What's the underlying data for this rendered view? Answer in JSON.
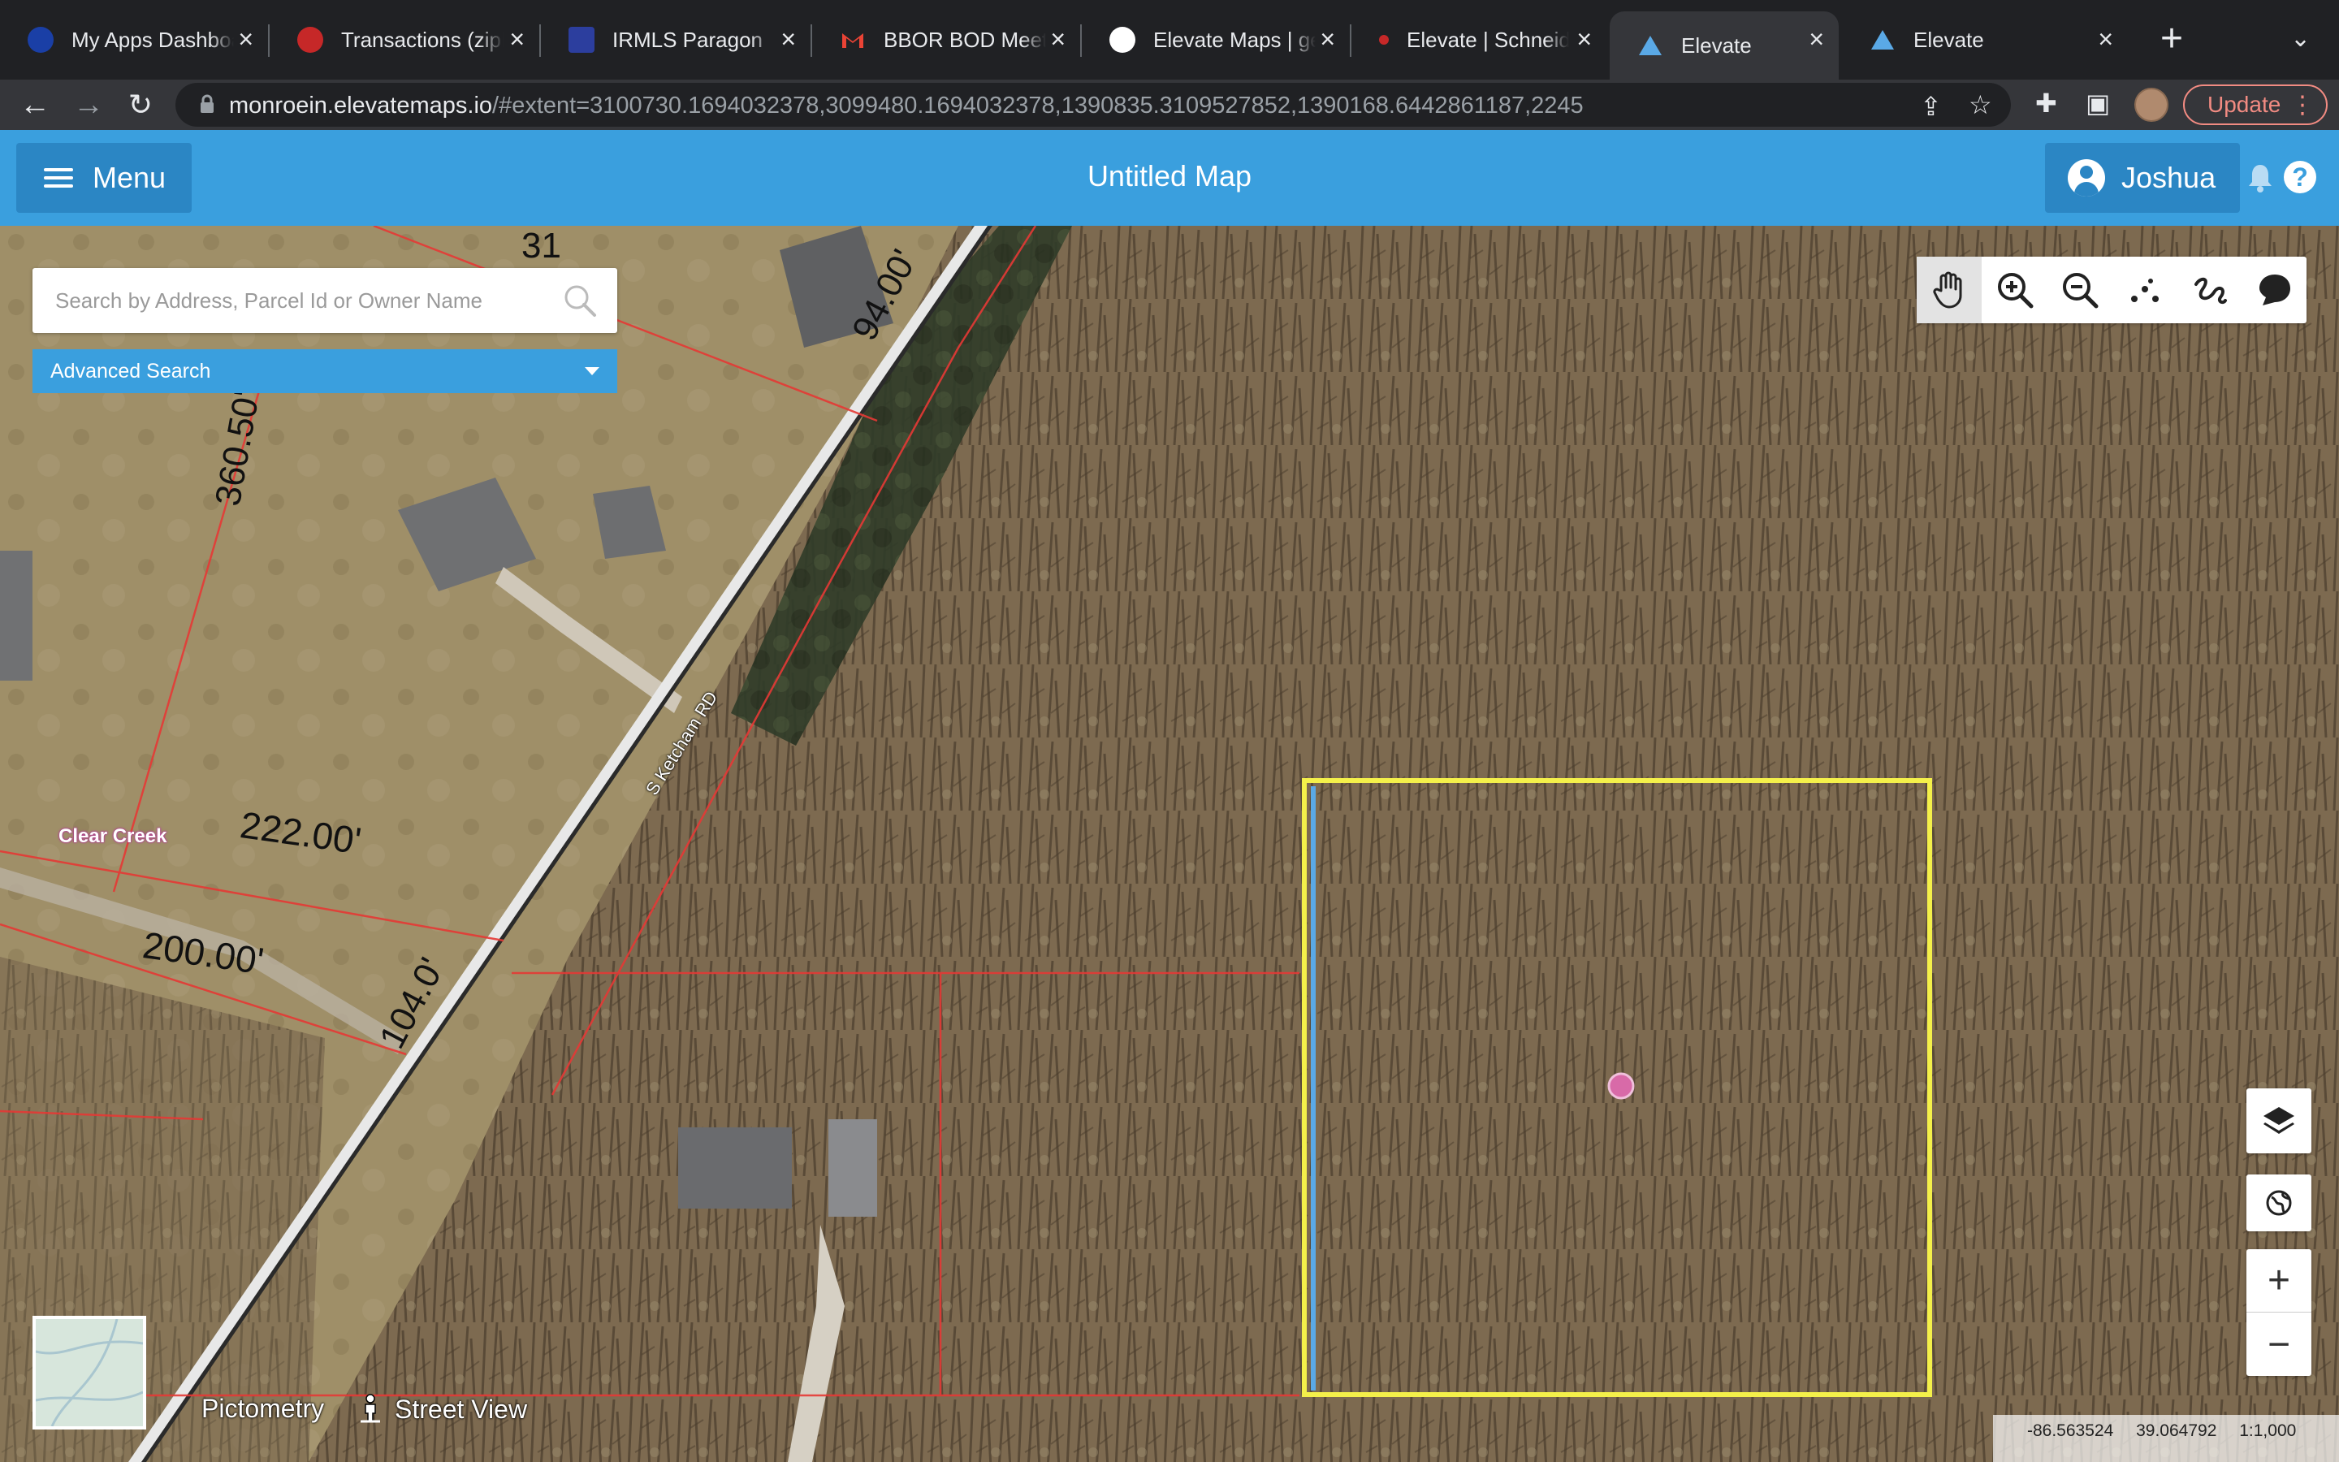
{
  "browser": {
    "tabs": [
      {
        "label": "My Apps Dashboard",
        "icon": "okta-icon",
        "color": "#1a3fa6"
      },
      {
        "label": "Transactions (zipForm)",
        "icon": "zipform-icon",
        "color": "#c62828"
      },
      {
        "label": "IRMLS Paragon",
        "icon": "paragon-icon",
        "color": "#2c3e9e"
      },
      {
        "label": "BBOR BOD Meeting",
        "icon": "gmail-icon",
        "color": "#ea4335"
      },
      {
        "label": "Elevate Maps | geo",
        "icon": "globe-icon",
        "color": "#ffffff"
      },
      {
        "label": "Elevate | Schneider",
        "icon": "schneider-icon",
        "color": "#c62828"
      },
      {
        "label": "Elevate",
        "icon": "elevate-icon",
        "color": "#5aa9e6",
        "active": true
      },
      {
        "label": "Elevate",
        "icon": "elevate-icon",
        "color": "#5aa9e6"
      }
    ],
    "url_host": "monroein.elevatemaps.io",
    "url_rest": "/#extent=3100730.1694032378,3099480.1694032378,1390835.3109527852,1390168.6442861187,2245",
    "update_label": "Update"
  },
  "app": {
    "menu_label": "Menu",
    "title": "Untitled Map",
    "user_name": "Joshua",
    "help_label": "?"
  },
  "search": {
    "placeholder": "Search by Address, Parcel Id or Owner Name",
    "advanced_label": "Advanced Search"
  },
  "map_labels": {
    "road": "S Ketcham RD",
    "creek": "Clear Creek",
    "dim_360": "360.50'",
    "dim_94": "94.00'",
    "dim_222": "222.00'",
    "dim_200": "200.00'",
    "dim_104": "104.0'",
    "dim_partial": "31"
  },
  "map_tools": [
    "pan-hand-icon",
    "zoom-in-icon",
    "zoom-out-icon",
    "select-points-icon",
    "freehand-icon",
    "speech-bubble-icon"
  ],
  "bottom": {
    "pictometry": "Pictometry",
    "street_view": "Street View"
  },
  "coords": {
    "lon": "-86.563524",
    "lat": "39.064792",
    "scale": "1:1,000"
  },
  "colors": {
    "header": "#3a9fde",
    "parcel_line": "#e53935",
    "selection": "#f4f04a",
    "marker": "#d86aa8"
  }
}
